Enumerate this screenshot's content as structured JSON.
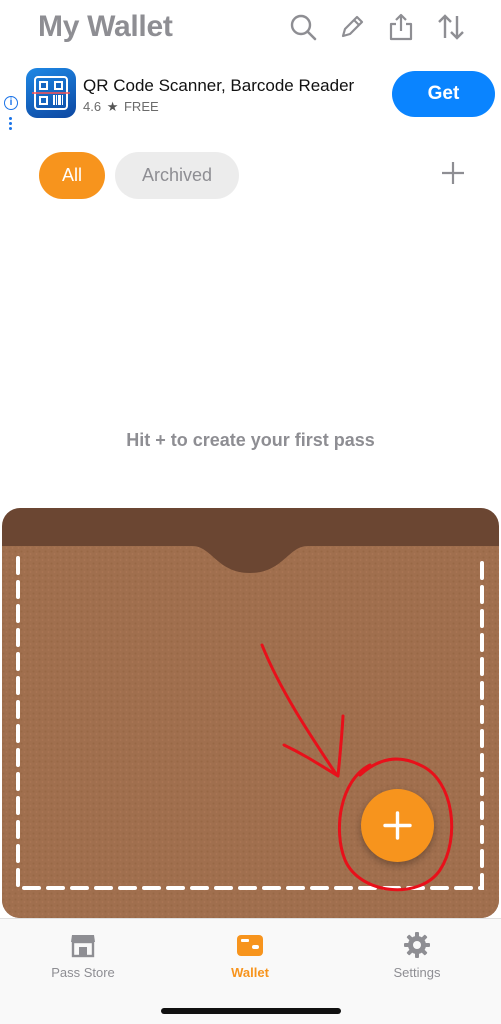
{
  "header": {
    "title": "My Wallet",
    "icons": [
      "search-icon",
      "edit-icon",
      "share-icon",
      "sort-icon"
    ]
  },
  "ad": {
    "info_glyph": "i",
    "app_name": "QR Code Scanner,  Barcode Reader",
    "rating": "4.6",
    "star": "★",
    "price": "FREE",
    "get_label": "Get"
  },
  "filters": {
    "all_label": "All",
    "archived_label": "Archived"
  },
  "empty_state": {
    "message": "Hit + to create your first pass"
  },
  "tabbar": {
    "tabs": [
      {
        "label": "Pass Store",
        "icon": "store-icon"
      },
      {
        "label": "Wallet",
        "icon": "wallet-icon"
      },
      {
        "label": "Settings",
        "icon": "gear-icon"
      }
    ],
    "active": "Wallet"
  },
  "colors": {
    "accent": "#f7941d",
    "ad_button": "#0a84ff",
    "wallet_leather": "#a06f4e",
    "wallet_dark": "#6b4632",
    "annotation": "#e8101a"
  }
}
